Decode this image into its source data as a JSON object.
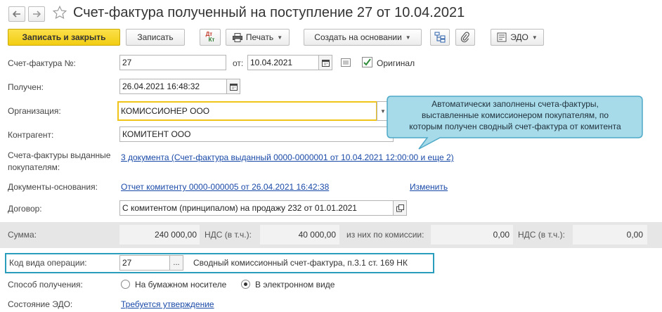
{
  "window": {
    "title": "Счет-фактура полученный на поступление 27 от 10.04.2021",
    "nav_back_icon": "arrow-left-icon",
    "nav_forward_icon": "arrow-right-icon",
    "favorite_icon": "star-icon"
  },
  "toolbar": {
    "save_close_label": "Записать и закрыть",
    "save_label": "Записать",
    "dtkt_top": "Дт",
    "dtkt_bottom": "Кт",
    "print_label": "Печать",
    "create_based_label": "Создать на основании",
    "edo_label": "ЭДО",
    "accent_color": "#f5d31c"
  },
  "form": {
    "invoice_no_label": "Счет-фактура №:",
    "invoice_no_value": "27",
    "date_from_label": "от:",
    "date_from_value": "10.04.2021",
    "original_label": "Оригинал",
    "original_checked": true,
    "received_label": "Получен:",
    "received_value": "26.04.2021 16:48:32",
    "organization_label": "Организация:",
    "organization_value": "КОМИССИОНЕР ООО",
    "counterparty_label": "Контрагент:",
    "counterparty_value": "КОМИТЕНТ ООО",
    "issued_invoices_label_line1": "Счета-фактуры выданные",
    "issued_invoices_label_line2": "покупателям:",
    "issued_invoices_link": "3 документа (Счет-фактура выданный 0000-0000001 от 10.04.2021 12:00:00 и еще 2)",
    "base_docs_label": "Документы-основания:",
    "base_docs_link": "Отчет комитенту 0000-000005 от 26.04.2021 16:42:38",
    "change_link": "Изменить",
    "contract_label": "Договор:",
    "contract_value": "С комитентом (принципалом) на продажу 232 от 01.01.2021"
  },
  "totals": {
    "sum_label": "Сумма:",
    "sum_value": "240 000,00",
    "vat_label": "НДС (в т.ч.):",
    "vat_value": "40 000,00",
    "commission_label": "из них по комиссии:",
    "commission_value": "0,00",
    "vat2_label": "НДС (в т.ч.):",
    "vat2_value": "0,00"
  },
  "operation": {
    "code_label": "Код вида операции:",
    "code_value": "27",
    "code_button": "...",
    "code_description": "Сводный комиссионный счет-фактура, п.3.1 ст. 169 НК",
    "highlight_color": "#2a9dbd"
  },
  "receipt": {
    "method_label": "Способ получения:",
    "option_paper": "На бумажном носителе",
    "option_electronic": "В электронном виде",
    "selected": "В электронном виде"
  },
  "edo": {
    "state_label": "Состояние ЭДО:",
    "state_link": "Требуется утверждение"
  },
  "callout": {
    "line1": "Автоматически заполнены счета-фактуры,",
    "line2": "выставленные комиссионером покупателям, по",
    "line3": "которым получен сводный счет-фактура от комитента",
    "background": "#a7dbe9"
  }
}
